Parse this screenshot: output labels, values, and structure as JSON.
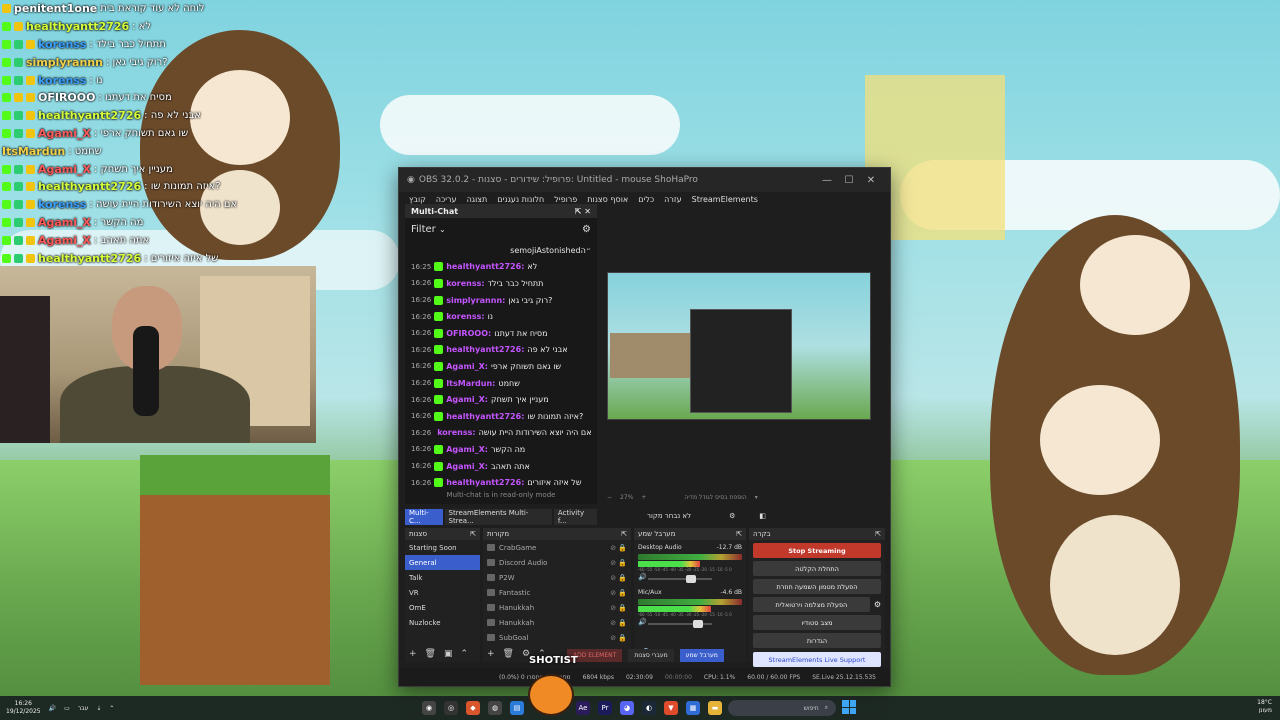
{
  "overlay_chat": [
    {
      "user": "penitent1one",
      "message": "לוחה לא עוד קוראת בית",
      "color": "#ffffff",
      "badges": [
        "y"
      ]
    },
    {
      "user": "healthyantt2726",
      "message": ": לא",
      "color": "#d6ff3a",
      "badges": [
        "k",
        "y"
      ]
    },
    {
      "user": "korenss",
      "message": ": תתחיל כבר בילד",
      "color": "#3aa0ff",
      "badges": [
        "k",
        "g",
        "y"
      ]
    },
    {
      "user": "simplyrannn",
      "message": ": רוק גיבי גאן?",
      "color": "#f1d24a",
      "badges": [
        "k",
        "g"
      ]
    },
    {
      "user": "korenss",
      "message": ": נו",
      "color": "#3aa0ff",
      "badges": [
        "k",
        "g",
        "y"
      ]
    },
    {
      "user": "OFIROOO",
      "message": ": מסיח את דעתנו",
      "color": "#ffffff",
      "badges": [
        "k",
        "y",
        "y"
      ]
    },
    {
      "user": "healthyantt2726",
      "message": ": אבני לא פה",
      "color": "#d6ff3a",
      "badges": [
        "k",
        "g",
        "y"
      ]
    },
    {
      "user": "Agami_X",
      "message": ": שו גאם תשוחק ארפי",
      "color": "#ff5a5a",
      "badges": [
        "k",
        "g",
        "y"
      ]
    },
    {
      "user": "ItsMardun",
      "message": ": שחמט",
      "color": "#f1d24a",
      "badges": []
    },
    {
      "user": "Agami_X",
      "message": ": מעניין איך תשחק",
      "color": "#ff5a5a",
      "badges": [
        "k",
        "g",
        "y"
      ]
    },
    {
      "user": "healthyantt2726",
      "message": ": איזה תמונות שו?",
      "color": "#d6ff3a",
      "badges": [
        "k",
        "g",
        "y"
      ]
    },
    {
      "user": "korenss",
      "message": ": אם היה יוצא השירודות היית עושה",
      "color": "#3aa0ff",
      "badges": [
        "k",
        "g",
        "y"
      ]
    },
    {
      "user": "Agami_X",
      "message": ": מה הקשר",
      "color": "#ff5a5a",
      "badges": [
        "k",
        "g",
        "y"
      ]
    },
    {
      "user": "Agami_X",
      "message": ": אתה תאהב",
      "color": "#ff5a5a",
      "badges": [
        "k",
        "g",
        "y"
      ]
    },
    {
      "user": "healthyantt2726",
      "message": ": של איזה איזורים",
      "color": "#d6ff3a",
      "badges": [
        "k",
        "g",
        "y"
      ]
    }
  ],
  "obs": {
    "title": "OBS 32.0.2 - פרופיל: שידורים - סצנות: Untitled - mouse ShoHaPro",
    "menu": [
      "קובץ",
      "עריכה",
      "תצוגה",
      "חלונות נעגנים",
      "פרופיל",
      "אוסף סצנות",
      "כלים",
      "עזרה",
      "StreamElements"
    ],
    "multichat": {
      "title": "Multi-Chat",
      "filter_label": "Filter",
      "header_line": "semojiAstonished״ה",
      "lines": [
        {
          "time": "16:25",
          "user": "healthyantt2726:",
          "msg": "לא",
          "color": "#c455ff"
        },
        {
          "time": "16:26",
          "user": "korenss:",
          "msg": "תתחיל כבר בילד",
          "color": "#c455ff"
        },
        {
          "time": "16:26",
          "user": "simplyrannn:",
          "msg": "רוק גיבי גאן?",
          "color": "#c455ff"
        },
        {
          "time": "16:26",
          "user": "korenss:",
          "msg": "נו",
          "color": "#c455ff"
        },
        {
          "time": "16:26",
          "user": "OFIROOO:",
          "msg": "מסיח את דעתנו",
          "color": "#c455ff"
        },
        {
          "time": "16:26",
          "user": "healthyantt2726:",
          "msg": "אבני לא פה",
          "color": "#c455ff"
        },
        {
          "time": "16:26",
          "user": "Agami_X:",
          "msg": "שו גאם תשוחק ארפי",
          "color": "#c455ff"
        },
        {
          "time": "16:26",
          "user": "ItsMardun:",
          "msg": "שחמט",
          "color": "#c455ff"
        },
        {
          "time": "16:26",
          "user": "Agami_X:",
          "msg": "מעניין איך תשחק",
          "color": "#c455ff"
        },
        {
          "time": "16:26",
          "user": "healthyantt2726:",
          "msg": "איזה תמונות שו?",
          "color": "#c455ff"
        },
        {
          "time": "16:26",
          "user": "korenss:",
          "msg": "אם היה יוצא השירודות היית עושה",
          "color": "#c455ff"
        },
        {
          "time": "16:26",
          "user": "Agami_X:",
          "msg": "מה הקשר",
          "color": "#c455ff"
        },
        {
          "time": "16:26",
          "user": "Agami_X:",
          "msg": "אתה תאהב",
          "color": "#c455ff"
        },
        {
          "time": "16:26",
          "user": "healthyantt2726:",
          "msg": "של איזה איזורים",
          "color": "#c455ff"
        }
      ],
      "footer": "Multi-chat is in read-only mode"
    },
    "preview_zoom": "27%",
    "preview_hint": "הוספת בסיס לגודל מדיה",
    "dock_tabs": [
      "Multi-C...",
      "StreamElements Multi-Strea...",
      "Activity f..."
    ],
    "no_source_label": "לא נבחר מקור",
    "scenes": {
      "title": "סצנות",
      "items": [
        "Starting Soon",
        "General",
        "Talk",
        "VR",
        "OmE",
        "Nuzlocke"
      ],
      "selected": "General"
    },
    "sources": {
      "title": "מקורות",
      "items": [
        "CrabGame",
        "Discord Audio",
        "P2W",
        "Fantastic",
        "Hanukkah",
        "Hanukkah",
        "SubGoal"
      ]
    },
    "mixer": {
      "title": "מערבל שמע",
      "channels": [
        {
          "name": "Desktop Audio",
          "db": "-12.7 dB",
          "volume": 0.6
        },
        {
          "name": "Mic/Aux",
          "db": "-4.6 dB",
          "volume": 0.7
        }
      ],
      "scale": "-60 -55 -50 -45 -40 -35 -30 -25 -20 -15 -10 -5 0"
    },
    "controls": {
      "title": "בקרה",
      "stop_streaming": "Stop Streaming",
      "start_recording": "התחלת הקלטה",
      "replay_buffer": "הפעלת מטמון השמעה חוזרת",
      "virtual_camera": "הפעלת מצלמה וירטואלית",
      "studio_mode": "מצב סטודיו",
      "settings": "הגדרות",
      "support": "StreamElements Live Support"
    },
    "bottom_tabs": {
      "add_element": "ADD ELEMENT",
      "transitions": "מעברי סצנות",
      "mixer": "מערבל שמע"
    },
    "status": {
      "dropped": "(0.0%) 0 מסגרות שהוחסרו",
      "kbps": "6804 kbps",
      "stream_time": "02:30:09",
      "rec_time": "00:00:00",
      "cpu": "CPU: 1.1%",
      "fps": "60.00 / 60.00 FPS",
      "version": "SE.Live 25.12.15.535"
    }
  },
  "overlay_brand": "SHOTIST",
  "taskbar": {
    "time": "16:26",
    "date": "19/12/2025",
    "lang": "עבר",
    "search_placeholder": "חיפוש",
    "weather": "18°C",
    "weather_desc": "מעונן"
  }
}
